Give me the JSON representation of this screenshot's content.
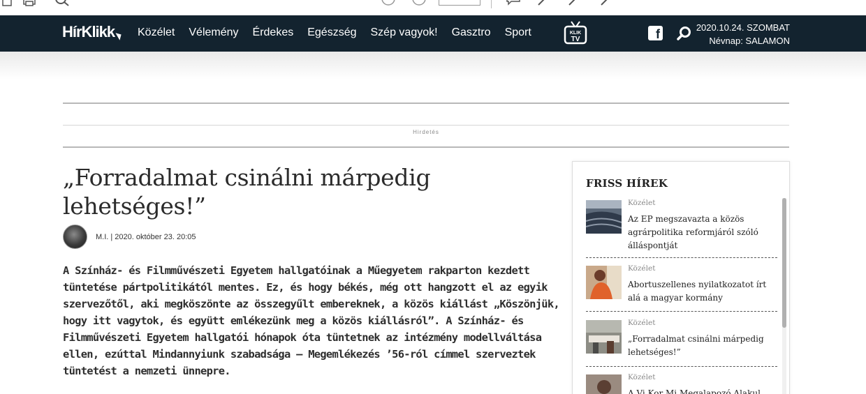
{
  "nav": {
    "logo": "HírKlikk",
    "items": [
      "Közélet",
      "Vélemény",
      "Érdekes",
      "Egészség",
      "Szép vagyok!",
      "Gasztro",
      "Sport"
    ],
    "tv_logo_text": "Klikk TV",
    "date": "2020.10.24. SZOMBAT",
    "nameday": "Névnap: SALAMON",
    "facebook_icon": "facebook-icon",
    "search_icon": "search-icon"
  },
  "ad": {
    "label": "Hirdetés"
  },
  "article": {
    "title": "„Forradalmat csinálni márpedig lehetséges!”",
    "byline": "M.I. | 2020. október 23. 20:05",
    "lead": "A Színház- és Filmművészeti Egyetem hallgatóinak a Műegyetem rakparton kezdett tüntetése pártpolitikától mentes. Ez, és hogy békés, még ott hangzott el az egyik szervezőtől, aki megköszönte az összegyűlt embereknek, a közös kiállást „Köszönjük, hogy itt vagytok, és együtt emlékezünk meg a közös kiállásról”. A Színház- és Filmművészeti Egyetem hallgatói hónapok óta tüntetnek az intézmény modellváltása ellen, ezúttal Mindannyiunk szabadsága – Megemlékezés ’56-ról címmel szerveztek tüntetést a nemzeti ünnepre."
  },
  "sidebar": {
    "title": "FRISS HÍREK",
    "items": [
      {
        "category": "Közélet",
        "headline": "Az EP megszavazta a közös agrárpolitika reformjáról szóló álláspontját"
      },
      {
        "category": "Közélet",
        "headline": "Abortuszellenes nyilatkozatot írt alá a magyar kormány"
      },
      {
        "category": "Közélet",
        "headline": "„Forradalmat csinálni márpedig lehetséges!”"
      },
      {
        "category": "Közélet",
        "headline": "A Vi Kor Mi Megalapozó Alakul"
      }
    ]
  },
  "colors": {
    "navbar": "#13232f",
    "text": "#2b2b2b",
    "divider": "#b8b8b8"
  }
}
